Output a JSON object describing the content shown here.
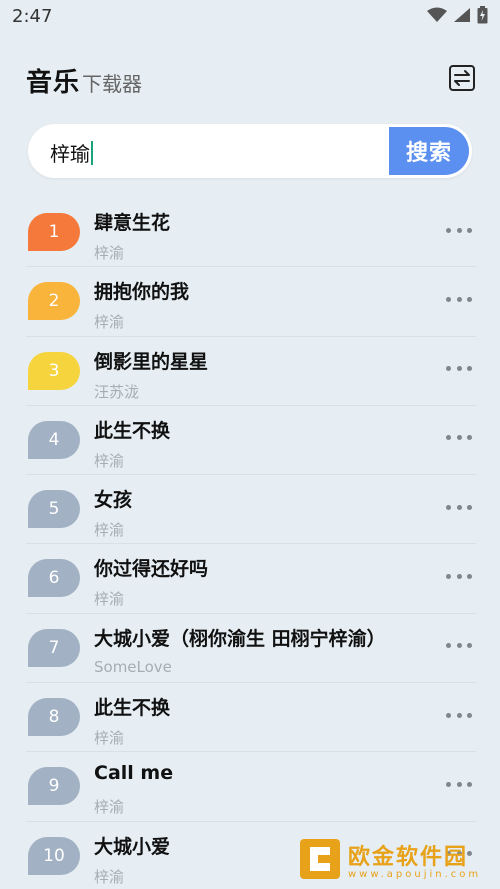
{
  "status": {
    "time": "2:47"
  },
  "header": {
    "title": "音乐",
    "subtitle": "下载器"
  },
  "search": {
    "value": "梓瑜",
    "button_label": "搜索"
  },
  "colors": {
    "rank1": "#f5793a",
    "rank2": "#f8b43b",
    "rank3": "#f6d43e",
    "rank_default": "#a2b2c4",
    "accent": "#5b8ff0"
  },
  "songs": [
    {
      "rank": "1",
      "title": "肆意生花",
      "artist": "梓渝"
    },
    {
      "rank": "2",
      "title": "拥抱你的我",
      "artist": "梓渝"
    },
    {
      "rank": "3",
      "title": "倒影里的星星",
      "artist": "汪苏泷"
    },
    {
      "rank": "4",
      "title": "此生不换",
      "artist": "梓渝"
    },
    {
      "rank": "5",
      "title": "女孩",
      "artist": "梓渝"
    },
    {
      "rank": "6",
      "title": "你过得还好吗",
      "artist": "梓渝"
    },
    {
      "rank": "7",
      "title": "大城小爱（栩你渝生 田栩宁梓渝）",
      "artist": "SomeLove"
    },
    {
      "rank": "8",
      "title": "此生不换",
      "artist": "梓渝"
    },
    {
      "rank": "9",
      "title": "Call me",
      "artist": "梓渝"
    },
    {
      "rank": "10",
      "title": "大城小爱",
      "artist": "梓渝"
    }
  ],
  "watermark": {
    "name": "欧金软件园",
    "url": "www.apoujin.com"
  }
}
